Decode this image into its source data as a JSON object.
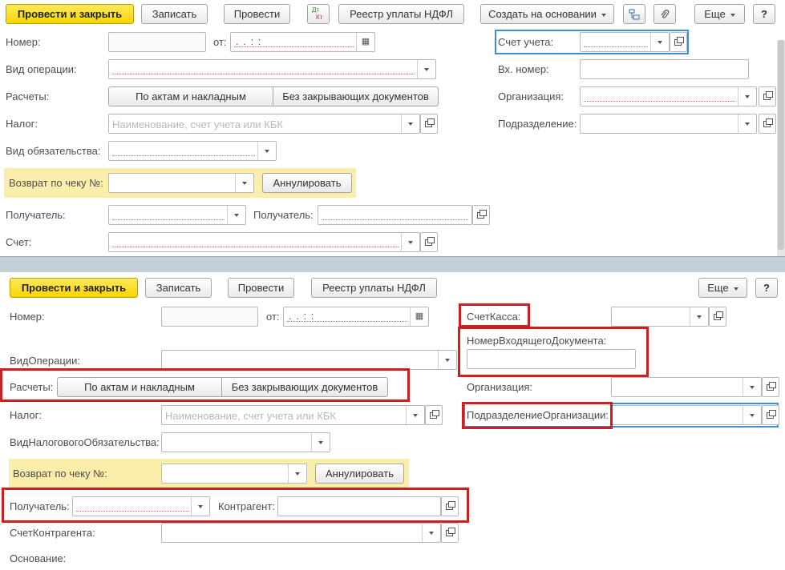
{
  "top": {
    "toolbar": {
      "post_close": "Провести и закрыть",
      "save": "Записать",
      "post": "Провести",
      "dtkt_icon_top": "Дт",
      "dtkt_icon_bottom": "Кт",
      "registry": "Реестр уплаты НДФЛ",
      "create_based": "Создать на основании",
      "more": "Еще",
      "help": "?"
    },
    "labels": {
      "number": "Номер:",
      "from": "от:",
      "operation_type": "Вид операции:",
      "settlements": "Расчеты:",
      "tax": "Налог:",
      "obligation_type": "Вид обязательства:",
      "refund": "Возврат по чеку №:",
      "recipient": "Получатель:",
      "recipient2": "Получатель:",
      "account": "Счет:",
      "account_of": "Счет учета:",
      "incoming_number": "Вх. номер:",
      "organization": "Организация:",
      "department": "Подразделение:"
    },
    "date_value": ".  .     :  :",
    "settlement_options": [
      "По актам и накладным",
      "Без закрывающих документов"
    ],
    "tax_placeholder": "Наименование, счет учета или КБК",
    "cancel": "Аннулировать"
  },
  "bottom": {
    "toolbar": {
      "post_close": "Провести и закрыть",
      "save": "Записать",
      "post": "Провести",
      "registry": "Реестр уплаты НДФЛ",
      "more": "Еще",
      "help": "?"
    },
    "labels": {
      "number": "Номер:",
      "from": "от:",
      "operation_type": "ВидОперации:",
      "settlements": "Расчеты:",
      "tax": "Налог:",
      "obligation_type": "ВидНалоговогоОбязательства:",
      "refund": "Возврат по чеку №:",
      "recipient": "Получатель:",
      "counterparty": "Контрагент:",
      "counterparty_account": "СчетКонтрагента:",
      "basis": "Основание:",
      "cash_account": "СчетКасса:",
      "incoming_doc_number": "НомерВходящегоДокумента:",
      "organization": "Организация:",
      "org_department": "ПодразделениеОрганизации:"
    },
    "date_value": ".  .     :  :",
    "settlement_options": [
      "По актам и накладным",
      "Без закрывающих документов"
    ],
    "tax_placeholder": "Наименование, счет учета или КБК",
    "cancel": "Аннулировать"
  },
  "colors": {
    "primary_button": "#f6d600",
    "highlight_panel": "#fbeeaa",
    "annotation_box": "#cc1f1f",
    "focus_border": "#3b8ed6",
    "separator": "#c5cfd8"
  },
  "icons": [
    "dtkt-icon",
    "structure-icon",
    "paperclip-icon",
    "calendar-icon",
    "dropdown-icon",
    "open-form-icon"
  ]
}
